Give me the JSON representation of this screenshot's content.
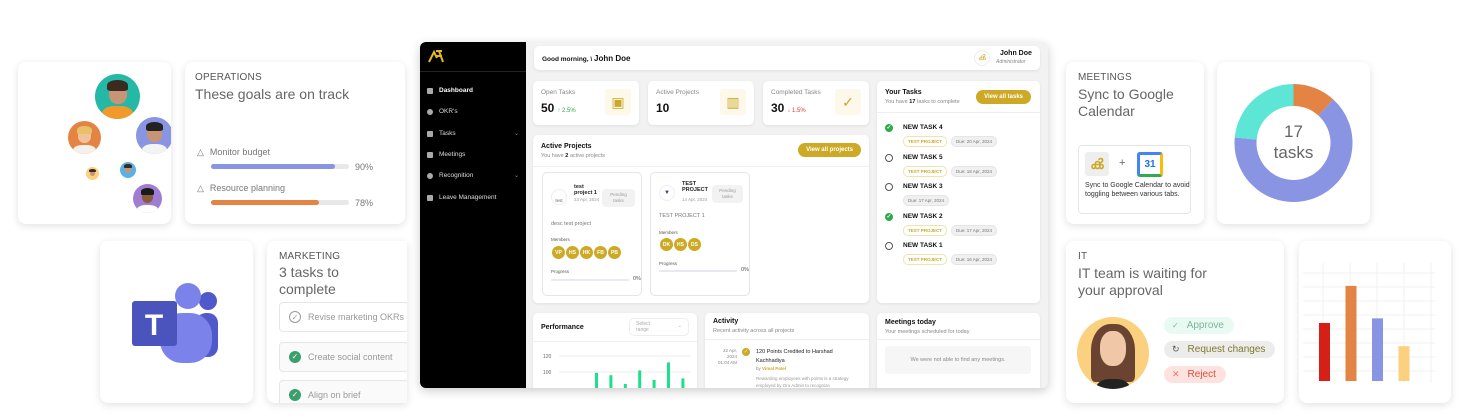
{
  "operations": {
    "category": "OPERATIONS",
    "headline": "These goals are on track",
    "goals": [
      {
        "label": "Monitor budget",
        "percent": 90,
        "display": "90%",
        "color": "#8994e2"
      },
      {
        "label": "Resource planning",
        "percent": 78,
        "display": "78%",
        "color": "#e38444"
      }
    ]
  },
  "marketing": {
    "category": "MARKETING",
    "headline": "3 tasks to complete",
    "tasks": [
      {
        "label": "Revise marketing OKRs",
        "done": false
      },
      {
        "label": "Create social content",
        "done": true
      },
      {
        "label": "Align on brief",
        "done": true
      }
    ]
  },
  "meetings": {
    "category": "MEETINGS",
    "headline": "Sync to Google Calendar",
    "plus": "+",
    "calendar_day": "31",
    "description": "Sync to Google Calendar to avoid toggling between various tabs."
  },
  "donut": {
    "count": "17",
    "unit": "tasks"
  },
  "it": {
    "category": "IT",
    "headline": "IT team is waiting for your approval",
    "actions": [
      {
        "label": "Approve",
        "icon": "check-icon"
      },
      {
        "label": "Request changes",
        "icon": "refresh-icon"
      },
      {
        "label": "Reject",
        "icon": "x-icon"
      }
    ]
  },
  "dashboard": {
    "greeting": "Good morning, \\",
    "user_name": "John Doe",
    "user_role": "Administrator",
    "nav": [
      {
        "label": "Dashboard",
        "active": true
      },
      {
        "label": "OKR's"
      },
      {
        "label": "Tasks",
        "expandable": true
      },
      {
        "label": "Meetings"
      },
      {
        "label": "Recognition",
        "expandable": true
      },
      {
        "label": "Leave Management"
      }
    ],
    "stats": [
      {
        "label": "Open Tasks",
        "value": "50",
        "change": "↑ 2.5%",
        "trend": "up"
      },
      {
        "label": "Active Projects",
        "value": "10"
      },
      {
        "label": "Completed Tasks",
        "value": "30",
        "change": "↓ 1.5%",
        "trend": "down"
      }
    ],
    "active_projects": {
      "title": "Active Projects",
      "subtitle_pre": "You have ",
      "count": "2",
      "subtitle_post": " active projects",
      "button": "View all projects",
      "projects": [
        {
          "name": "test project 1",
          "date": "23 Apr, 2024",
          "status": "Pending tasks",
          "logo_alt": "test",
          "description": "desc test project",
          "members_label": "Members",
          "members": [
            "VP",
            "HS",
            "HK",
            "FB",
            "PB"
          ],
          "progress_label": "Progress",
          "progress": "0%"
        },
        {
          "name": "TEST PROJECT",
          "date": "14 Apr, 2024",
          "status": "Pending tasks",
          "description": "TEST PROJECT 1",
          "members_label": "Members",
          "members": [
            "DK",
            "HS",
            "DS"
          ],
          "progress_label": "Progress",
          "progress": "0%"
        }
      ]
    },
    "your_tasks": {
      "title": "Your Tasks",
      "subtitle_pre": "You have ",
      "count": "17",
      "subtitle_post": " tasks to complete",
      "button": "View all tasks",
      "tasks": [
        {
          "name": "NEW TASK 4",
          "done": true,
          "project": "TEST PROJECT",
          "due": "Due: 20 Apr, 2024"
        },
        {
          "name": "NEW TASK 5",
          "done": false,
          "project": "TEST PROJECT",
          "due": "Due: 18 Apr, 2024"
        },
        {
          "name": "NEW TASK 3",
          "done": false,
          "project": "",
          "due": "Due: 17 Apr, 2024"
        },
        {
          "name": "NEW TASK 2",
          "done": true,
          "project": "TEST PROJECT",
          "due": "Due: 17 Apr, 2024"
        },
        {
          "name": "NEW TASK 1",
          "done": false,
          "project": "TEST PROJECT",
          "due": "Due: 16 Apr, 2024"
        }
      ]
    },
    "performance": {
      "title": "Performance",
      "select_placeholder": "Select range"
    },
    "activity": {
      "title": "Activity",
      "subtitle": "Recent activity across all projects",
      "item": {
        "date": "22 Apr, 2024",
        "time": "01:04 AM",
        "title": "120 Points Credited to Harshad Kachhadiya",
        "by_label": "by",
        "by": "Vimal Patel",
        "text": "Rewarding employees with points is a strategy employed by Oro Admin to recognize"
      }
    },
    "meetings_today": {
      "title": "Meetings today",
      "subtitle": "Your meetings scheduled for today",
      "empty": "We were not able to find any meetings."
    }
  },
  "chart_data": [
    {
      "type": "pie",
      "title": "17 tasks",
      "values": [
        2,
        11,
        4
      ],
      "colors": [
        "#e38444",
        "#8994e2",
        "#5de6d6"
      ]
    },
    {
      "type": "bar",
      "categories": [
        "1",
        "2",
        "3",
        "4"
      ],
      "values": [
        50,
        82,
        54,
        30
      ],
      "colors": [
        "#d42016",
        "#e38444",
        "#8994e2",
        "#fbd07e"
      ],
      "ylim": [
        0,
        100
      ],
      "grid": true
    },
    {
      "type": "bar",
      "title": "Performance",
      "yticks": [
        100,
        120
      ],
      "values": [
        99,
        96,
        85,
        102,
        90,
        112,
        92
      ],
      "color": "#1fe08a"
    }
  ]
}
